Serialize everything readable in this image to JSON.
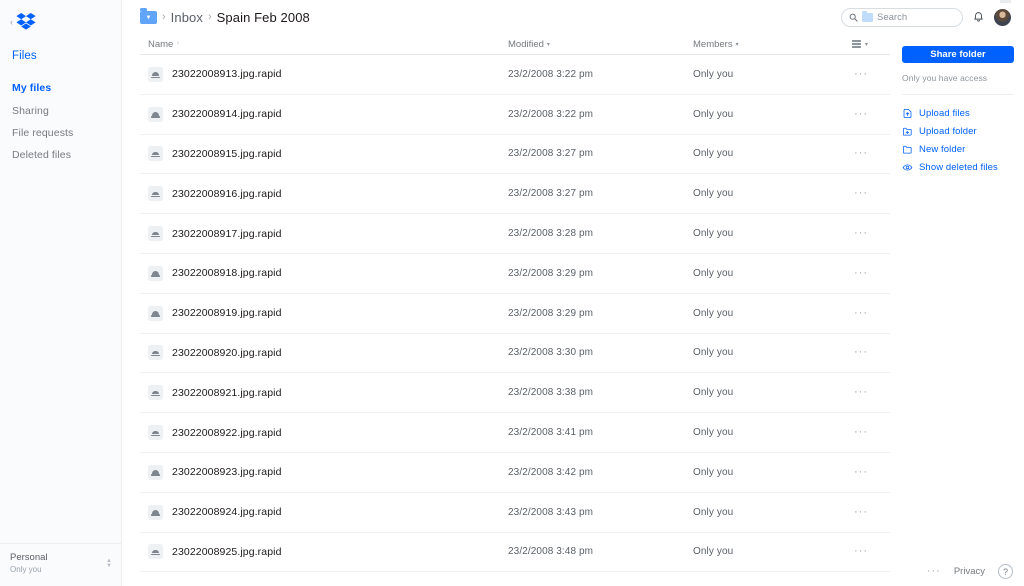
{
  "sidebar": {
    "collapse_icon": "chevron-left-icon",
    "logo": "dropbox-logo",
    "files_header": "Files",
    "items": [
      {
        "label": "My files",
        "active": true
      },
      {
        "label": "Sharing",
        "active": false
      },
      {
        "label": "File requests",
        "active": false
      },
      {
        "label": "Deleted files",
        "active": false
      }
    ],
    "account": {
      "name": "Personal",
      "sub": "Only you",
      "switcher_icon": "up-down-chevron-icon"
    }
  },
  "topbar": {
    "breadcrumb": {
      "folder_icon": "blue-folder-icon",
      "separator": "›",
      "crumbs": [
        "Inbox",
        "Spain Feb 2008"
      ]
    },
    "search": {
      "icon": "search-icon",
      "scope_icon": "folder-scope-icon",
      "placeholder": "Search",
      "value": ""
    },
    "notifications_icon": "bell-icon",
    "avatar": "user-avatar"
  },
  "table": {
    "columns": {
      "name": "Name",
      "name_sort": "↑",
      "modified": "Modified",
      "members": "Members",
      "caret": "▾",
      "view_icon": "list-view-icon"
    },
    "row_menu": "···",
    "file_icon": "image-file-icon",
    "rows": [
      {
        "name": "23022008913.jpg.rapid",
        "modified": "23/2/2008 3:22 pm",
        "members": "Only you"
      },
      {
        "name": "23022008914.jpg.rapid",
        "modified": "23/2/2008 3:22 pm",
        "members": "Only you"
      },
      {
        "name": "23022008915.jpg.rapid",
        "modified": "23/2/2008 3:27 pm",
        "members": "Only you"
      },
      {
        "name": "23022008916.jpg.rapid",
        "modified": "23/2/2008 3:27 pm",
        "members": "Only you"
      },
      {
        "name": "23022008917.jpg.rapid",
        "modified": "23/2/2008 3:28 pm",
        "members": "Only you"
      },
      {
        "name": "23022008918.jpg.rapid",
        "modified": "23/2/2008 3:29 pm",
        "members": "Only you"
      },
      {
        "name": "23022008919.jpg.rapid",
        "modified": "23/2/2008 3:29 pm",
        "members": "Only you"
      },
      {
        "name": "23022008920.jpg.rapid",
        "modified": "23/2/2008 3:30 pm",
        "members": "Only you"
      },
      {
        "name": "23022008921.jpg.rapid",
        "modified": "23/2/2008 3:38 pm",
        "members": "Only you"
      },
      {
        "name": "23022008922.jpg.rapid",
        "modified": "23/2/2008 3:41 pm",
        "members": "Only you"
      },
      {
        "name": "23022008923.jpg.rapid",
        "modified": "23/2/2008 3:42 pm",
        "members": "Only you"
      },
      {
        "name": "23022008924.jpg.rapid",
        "modified": "23/2/2008 3:43 pm",
        "members": "Only you"
      },
      {
        "name": "23022008925.jpg.rapid",
        "modified": "23/2/2008 3:48 pm",
        "members": "Only you"
      }
    ]
  },
  "right_panel": {
    "share_button": "Share folder",
    "access_note": "Only you have access",
    "actions": [
      {
        "label": "Upload files",
        "icon": "upload-file-icon"
      },
      {
        "label": "Upload folder",
        "icon": "upload-folder-icon"
      },
      {
        "label": "New folder",
        "icon": "new-folder-icon"
      },
      {
        "label": "Show deleted files",
        "icon": "eye-icon"
      }
    ]
  },
  "footer": {
    "dots": "···",
    "privacy": "Privacy",
    "help": "?"
  },
  "colors": {
    "brand_blue": "#0061fe",
    "sidebar_bg": "#fafbfc",
    "text_primary": "#1e1919",
    "text_muted": "#767b7f"
  }
}
